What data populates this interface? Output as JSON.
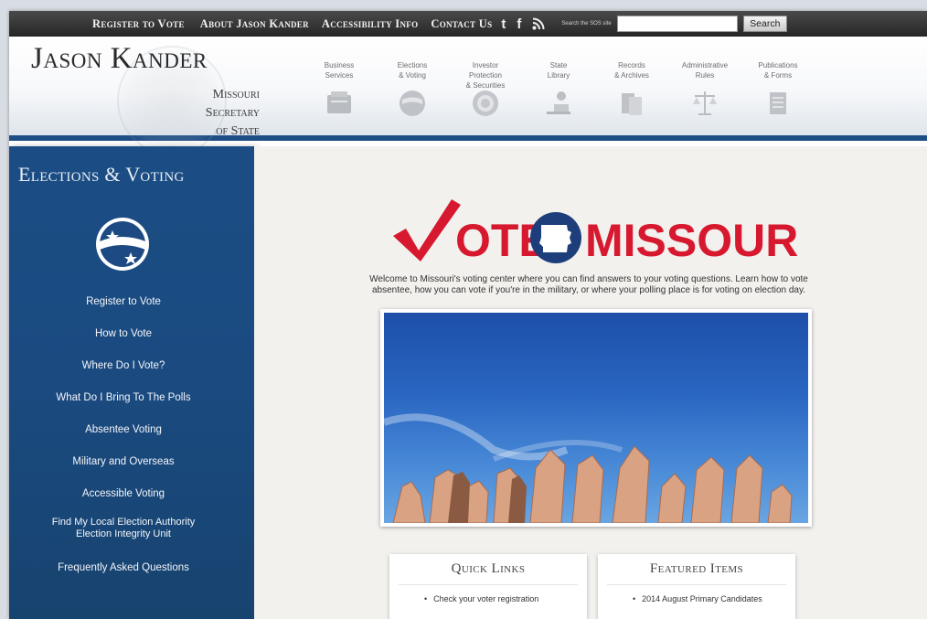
{
  "topbar": {
    "links": [
      "Register to Vote",
      "About Jason Kander",
      "Accessibility Info",
      "Contact Us"
    ],
    "social": {
      "twitter": "t",
      "facebook": "f"
    },
    "search_label": "Search the SOS site",
    "search_value": "",
    "search_button": "Search"
  },
  "header": {
    "name": "Jason Kander",
    "subtitle": [
      "Missouri",
      "Secretary",
      "of State"
    ],
    "nav": [
      {
        "line1": "Business",
        "line2": "Services",
        "icon": "business-services-icon"
      },
      {
        "line1": "Elections",
        "line2": "& Voting",
        "icon": "elections-globe-icon"
      },
      {
        "line1": "Investor Protection",
        "line2": "& Securities",
        "icon": "investor-seal-icon"
      },
      {
        "line1": "State",
        "line2": "Library",
        "icon": "library-reader-icon"
      },
      {
        "line1": "Records",
        "line2": "& Archives",
        "icon": "records-archives-icon"
      },
      {
        "line1": "Administrative",
        "line2": "Rules",
        "icon": "scales-icon"
      },
      {
        "line1": "Publications",
        "line2": "& Forms",
        "icon": "forms-icon"
      }
    ]
  },
  "sidebar": {
    "title": "Elections & Voting",
    "items": [
      {
        "label": "Register to Vote"
      },
      {
        "label": "How to Vote"
      },
      {
        "label": "Where Do I Vote?"
      },
      {
        "label": "What Do I Bring To The Polls"
      },
      {
        "label": "Absentee Voting"
      },
      {
        "label": "Military and Overseas"
      },
      {
        "label": "Accessible Voting"
      },
      {
        "label": "Find My Local Election Authority",
        "label2": "Election Integrity Unit"
      },
      {
        "label": "Frequently Asked Questions"
      }
    ]
  },
  "main": {
    "logo_left": "OTE",
    "logo_right": "MISSOURI",
    "intro": "Welcome to Missouri's voting center where you can find answers to your voting questions. Learn how to vote absentee, how you can vote if you're in the military, or where your polling place is for voting on election day.",
    "quick_links": {
      "title": "Quick Links",
      "items": [
        "Check your voter registration"
      ]
    },
    "featured": {
      "title": "Featured Items",
      "items": [
        "2014 August Primary Candidates"
      ]
    }
  },
  "colors": {
    "sidebar_blue": "#1b4d84",
    "header_rule": "#1f4e86",
    "vote_red": "#d7192f",
    "missouri_blue": "#1d3e7a"
  }
}
